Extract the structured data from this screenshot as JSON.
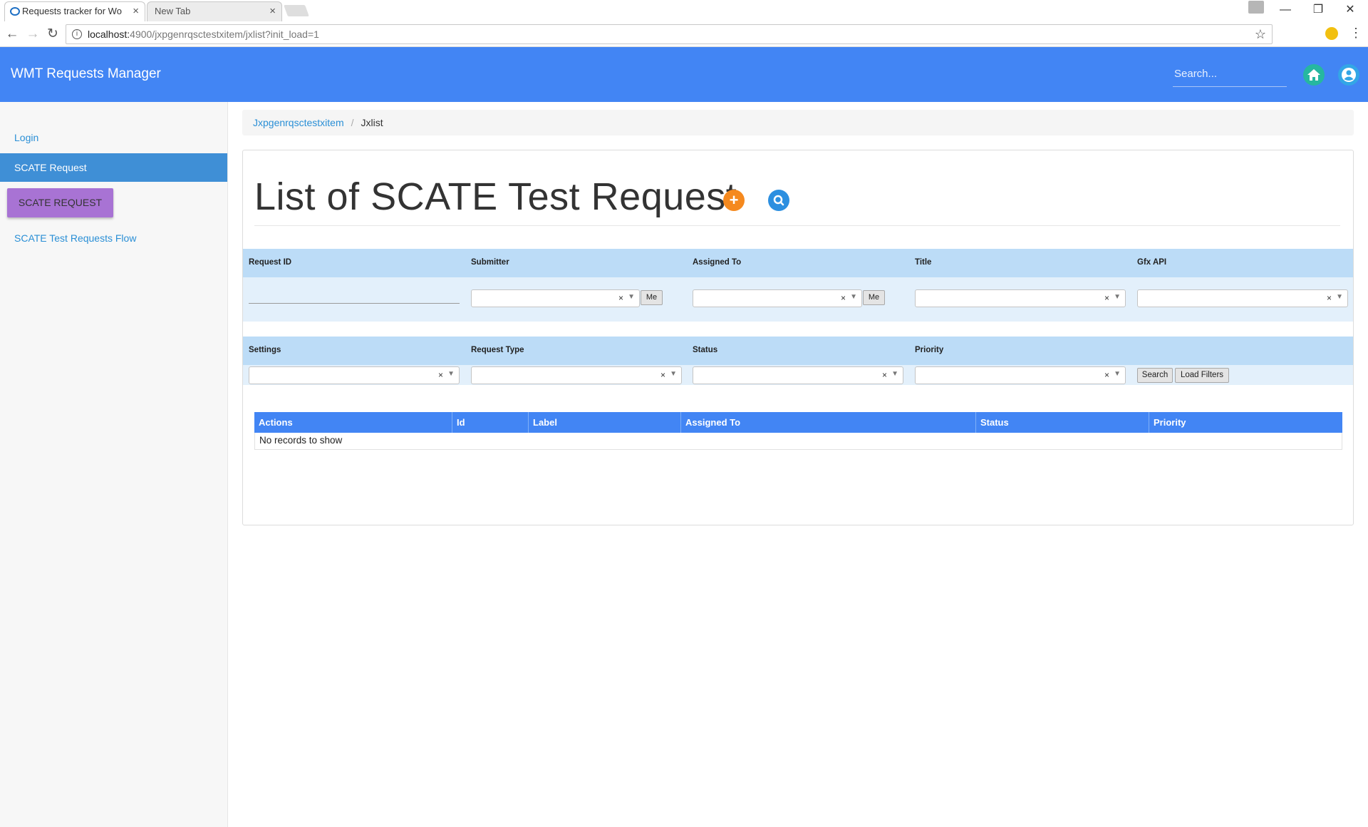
{
  "browser": {
    "tabs": [
      {
        "label": "Requests tracker for Wor"
      },
      {
        "label": "New Tab"
      }
    ],
    "tab_close": "×",
    "url_host": "localhost:",
    "url_rest": "4900/jxpgenrqsctestxitem/jxlist?init_load=1",
    "window_controls": {
      "minimize": "—",
      "maximize": "❐",
      "close": "✕"
    },
    "nav": {
      "back": "←",
      "forward": "→",
      "reload": "↻"
    },
    "star": "☆",
    "menu": "⋮"
  },
  "header": {
    "title": "WMT Requests Manager",
    "search_placeholder": "Search...",
    "accent": "#4285f4"
  },
  "sidebar": {
    "login": "Login",
    "active_item": "SCATE Request",
    "button": "SCATE REQUEST",
    "flow_link": "SCATE Test Requests Flow"
  },
  "breadcrumb": {
    "parent": "Jxpgenrqsctestxitem",
    "separator": "/",
    "current": "Jxlist"
  },
  "main": {
    "title": "List of SCATE Test Request",
    "add_glyph": "+",
    "filters_row1": {
      "request_id": "Request ID",
      "submitter": "Submitter",
      "assigned_to": "Assigned To",
      "title": "Title",
      "gfx_api": "Gfx API"
    },
    "filters_row2": {
      "settings": "Settings",
      "request_type": "Request Type",
      "status": "Status",
      "priority": "Priority"
    },
    "me_label": "Me",
    "clear_glyph": "×",
    "arrow_glyph": "▼",
    "search_button": "Search",
    "load_filters_button": "Load Filters"
  },
  "grid": {
    "columns": [
      "Actions",
      "Id",
      "Label",
      "Assigned To",
      "Status",
      "Priority"
    ],
    "empty_message": "No records to show"
  }
}
